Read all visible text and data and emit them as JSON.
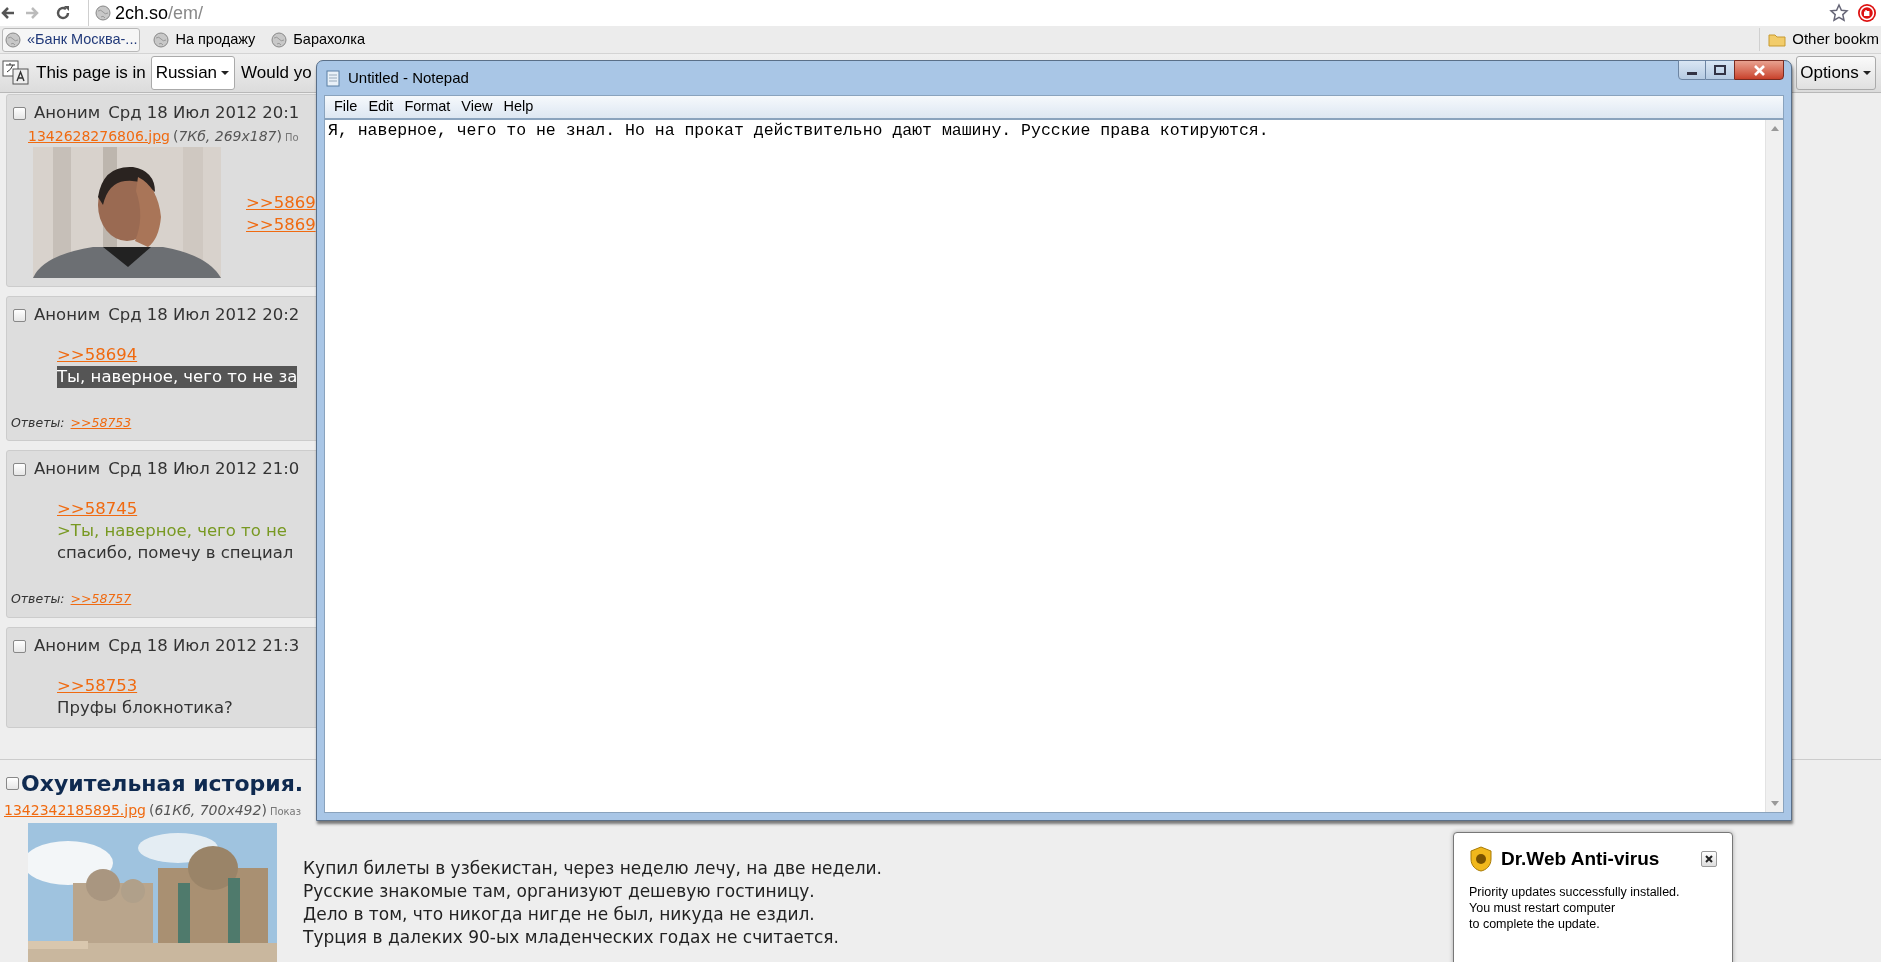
{
  "browser": {
    "url_host": "2ch.so",
    "url_path": "/em/",
    "bookmarks": [
      {
        "label": "«Банк Москва-...",
        "hovered": true
      },
      {
        "label": "На продажу",
        "hovered": false
      },
      {
        "label": "Барахолка",
        "hovered": false
      }
    ],
    "other_bookmarks": "Other bookm"
  },
  "translate_bar": {
    "prefix": "This page is in",
    "language": "Russian",
    "question": "Would yo",
    "options": "Options"
  },
  "posts": [
    {
      "checked": false,
      "author": "Аноним",
      "date": "Срд 18 Июл 2012 20:1",
      "file": {
        "name": "1342628276806.jpg",
        "info": "(*7Кб, 269x187*)",
        "show": "По"
      },
      "lines": [
        {
          "kind": "link",
          "text": ">>5869"
        },
        {
          "kind": "link",
          "text": ">>5869"
        }
      ]
    },
    {
      "checked": false,
      "author": "Аноним",
      "date": "Срд 18 Июл 2012 20:2",
      "lines": [
        {
          "kind": "link",
          "text": ">>58694"
        },
        {
          "kind": "selected",
          "text": "Ты, наверное, чего то не за"
        }
      ],
      "replies_label": "Ответы:",
      "replies": [
        ">>58753"
      ]
    },
    {
      "checked": false,
      "author": "Аноним",
      "date": "Срд 18 Июл 2012 21:0",
      "lines": [
        {
          "kind": "link",
          "text": ">>58745"
        },
        {
          "kind": "quote",
          "text": ">Ты, наверное, чего то не"
        },
        {
          "kind": "text",
          "text": "спасибо, помечу в специал"
        }
      ],
      "replies_label": "Ответы:",
      "replies": [
        ">>58757"
      ]
    },
    {
      "checked": false,
      "author": "Аноним",
      "date": "Срд 18 Июл 2012 21:3",
      "lines": [
        {
          "kind": "link",
          "text": ">>58753"
        },
        {
          "kind": "text",
          "text": "Пруфы блокнотика?"
        }
      ]
    }
  ],
  "thread": {
    "checked": false,
    "title": "Охуительная история.",
    "file": {
      "name": "1342342185895.jpg",
      "info": "(*61Кб, 700x492*)",
      "show": "Показ"
    },
    "lines": [
      "Купил билеты в узбекистан, через неделю лечу, на две недели.",
      "Русские знакомые там, организуют дешевую гостиницу.",
      "Дело в том, что никогда нигде не был, никуда не ездил.",
      "Турция в далеких 90-ых младенческих годах не считается."
    ]
  },
  "notepad": {
    "title": "Untitled - Notepad",
    "menu": [
      "File",
      "Edit",
      "Format",
      "View",
      "Help"
    ],
    "text": "Я, наверное, чего то не знал. Но на прокат действительно дают машину. Русские права котируются."
  },
  "popup": {
    "title": "Dr.Web Anti-virus",
    "message": "Priority updates successfully installed.\nYou must restart computer\nto complete the update."
  }
}
